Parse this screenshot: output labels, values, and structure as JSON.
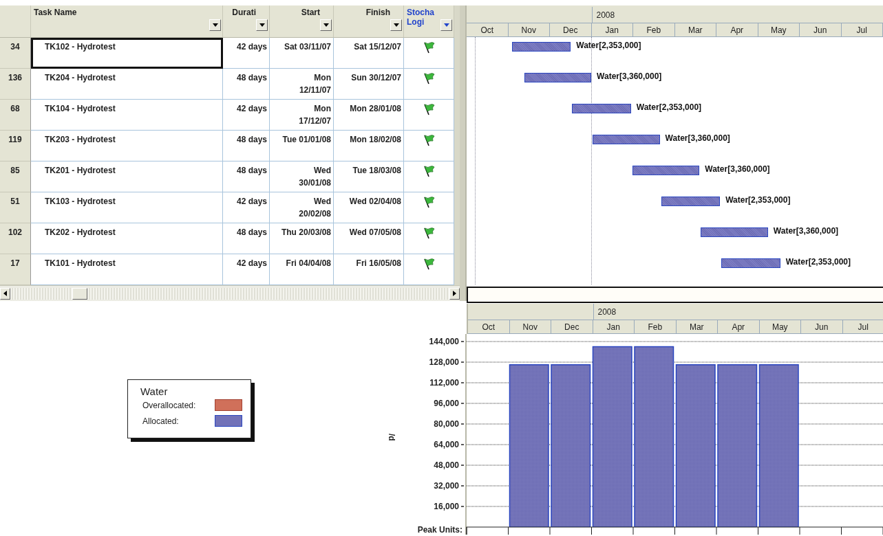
{
  "task_table": {
    "columns": [
      {
        "label": "Task Name"
      },
      {
        "label": "Durati"
      },
      {
        "label": "Start"
      },
      {
        "label": "Finish"
      },
      {
        "label": "Stocha\nLogi"
      }
    ],
    "rows": [
      {
        "id": "34",
        "name": "TK102 - Hydrotest",
        "duration": "42 days",
        "start": "Sat 03/11/07",
        "finish": "Sat 15/12/07",
        "flag": true,
        "selected": true,
        "bar_label": "Water[2,353,000]"
      },
      {
        "id": "136",
        "name": "TK204 - Hydrotest",
        "duration": "48 days",
        "start": "Mon\n12/11/07",
        "finish": "Sun 30/12/07",
        "flag": true,
        "selected": false,
        "bar_label": "Water[3,360,000]"
      },
      {
        "id": "68",
        "name": "TK104 - Hydrotest",
        "duration": "42 days",
        "start": "Mon\n17/12/07",
        "finish": "Mon 28/01/08",
        "flag": true,
        "selected": false,
        "bar_label": "Water[2,353,000]"
      },
      {
        "id": "119",
        "name": "TK203 - Hydrotest",
        "duration": "48 days",
        "start": "Tue 01/01/08",
        "finish": "Mon 18/02/08",
        "flag": true,
        "selected": false,
        "bar_label": "Water[3,360,000]"
      },
      {
        "id": "85",
        "name": "TK201 - Hydrotest",
        "duration": "48 days",
        "start": "Wed\n30/01/08",
        "finish": "Tue 18/03/08",
        "flag": true,
        "selected": false,
        "bar_label": "Water[3,360,000]"
      },
      {
        "id": "51",
        "name": "TK103 - Hydrotest",
        "duration": "42 days",
        "start": "Wed\n20/02/08",
        "finish": "Wed 02/04/08",
        "flag": true,
        "selected": false,
        "bar_label": "Water[2,353,000]"
      },
      {
        "id": "102",
        "name": "TK202 - Hydrotest",
        "duration": "48 days",
        "start": "Thu 20/03/08",
        "finish": "Wed 07/05/08",
        "flag": true,
        "selected": false,
        "bar_label": "Water[3,360,000]"
      },
      {
        "id": "17",
        "name": "TK101 - Hydrotest",
        "duration": "42 days",
        "start": "Fri 04/04/08",
        "finish": "Fri 16/05/08",
        "flag": true,
        "selected": false,
        "bar_label": "Water[2,353,000]"
      }
    ]
  },
  "gantt": {
    "year": "2008",
    "months": [
      "Oct",
      "Nov",
      "Dec",
      "Jan",
      "Feb",
      "Mar",
      "Apr",
      "May",
      "Jun",
      "Jul"
    ]
  },
  "legend": {
    "title": "Water",
    "items": [
      {
        "label": "Overallocated:",
        "color": "#d0705a"
      },
      {
        "label": "Allocated:",
        "color": "#7272b8"
      }
    ]
  },
  "histogram": {
    "year": "2008",
    "peak_units_label": "Peak Units:",
    "chart_data": {
      "type": "bar",
      "ylabel": "/d",
      "categories": [
        "Oct",
        "Nov",
        "Dec",
        "Jan",
        "Feb",
        "Mar",
        "Apr",
        "May",
        "Jun",
        "Jul"
      ],
      "values": [
        null,
        126000,
        126000,
        140000,
        140000,
        126000,
        126000,
        126000,
        null,
        null
      ],
      "ylim": [
        0,
        144000
      ],
      "grid": true,
      "yticks": [
        {
          "value": 16000,
          "label": "16,000"
        },
        {
          "value": 32000,
          "label": "32,000"
        },
        {
          "value": 48000,
          "label": "48,000"
        },
        {
          "value": 64000,
          "label": "64,000"
        },
        {
          "value": 80000,
          "label": "80,000"
        },
        {
          "value": 96000,
          "label": "96,000"
        },
        {
          "value": 112000,
          "label": "112,000"
        },
        {
          "value": 128000,
          "label": "128,000"
        },
        {
          "value": 144000,
          "label": "144,000"
        }
      ]
    }
  }
}
